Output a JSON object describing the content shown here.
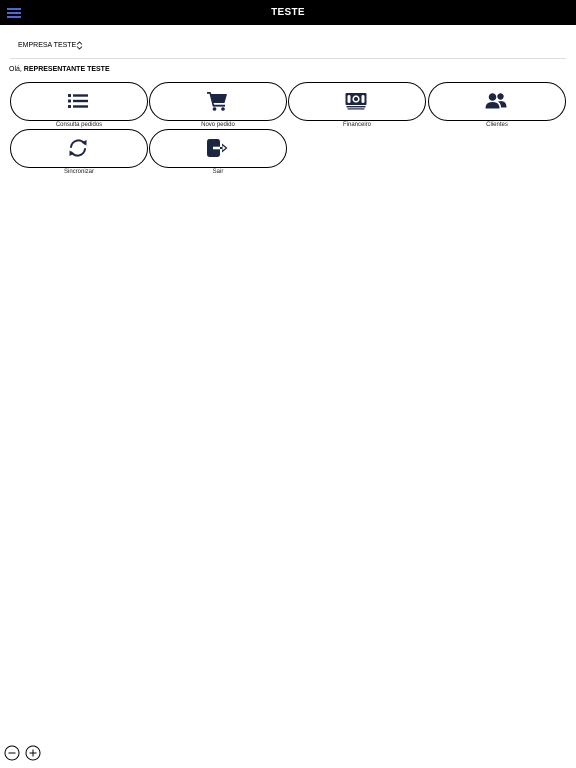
{
  "app": {
    "title": "TESTE"
  },
  "company": {
    "name": "EMPRESA TESTE"
  },
  "greeting": {
    "prefix": "Olá,",
    "name": "REPRESENTANTE TESTE"
  },
  "menu": [
    {
      "label": "Consulta pedidos",
      "icon": "list-icon"
    },
    {
      "label": "Novo pedido",
      "icon": "cart-icon"
    },
    {
      "label": "Financeiro",
      "icon": "money-icon"
    },
    {
      "label": "Clientes",
      "icon": "users-icon"
    },
    {
      "label": "Sincronizar",
      "icon": "sync-icon"
    },
    {
      "label": "Sair",
      "icon": "logout-icon"
    }
  ],
  "colors": {
    "header": "#000000",
    "icon": "#1c2541",
    "accent": "#4a6bd6"
  }
}
